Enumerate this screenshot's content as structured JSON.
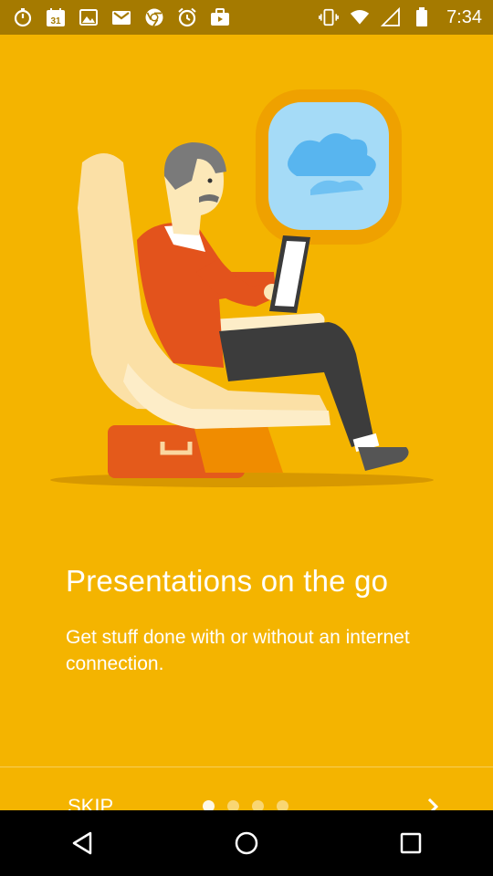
{
  "status_bar": {
    "time": "7:34",
    "left_icons": [
      "stopwatch-icon",
      "calendar-icon",
      "gallery-icon",
      "gmail-icon",
      "chrome-icon",
      "alarm-icon",
      "briefcase-icon"
    ],
    "calendar_day": "31",
    "right_icons": [
      "vibrate-icon",
      "wifi-icon",
      "signal-icon",
      "battery-icon"
    ]
  },
  "onboarding": {
    "title": "Presentations on the go",
    "description": "Get stuff done with or without an internet connection.",
    "skip_label": "SKIP",
    "page_count": 4,
    "current_page": 1
  },
  "colors": {
    "background": "#F4B400",
    "status_bar": "#A57A00",
    "nav_bar": "#000000"
  },
  "nav_bar": {
    "buttons": [
      "back-icon",
      "home-icon",
      "recents-icon"
    ]
  }
}
